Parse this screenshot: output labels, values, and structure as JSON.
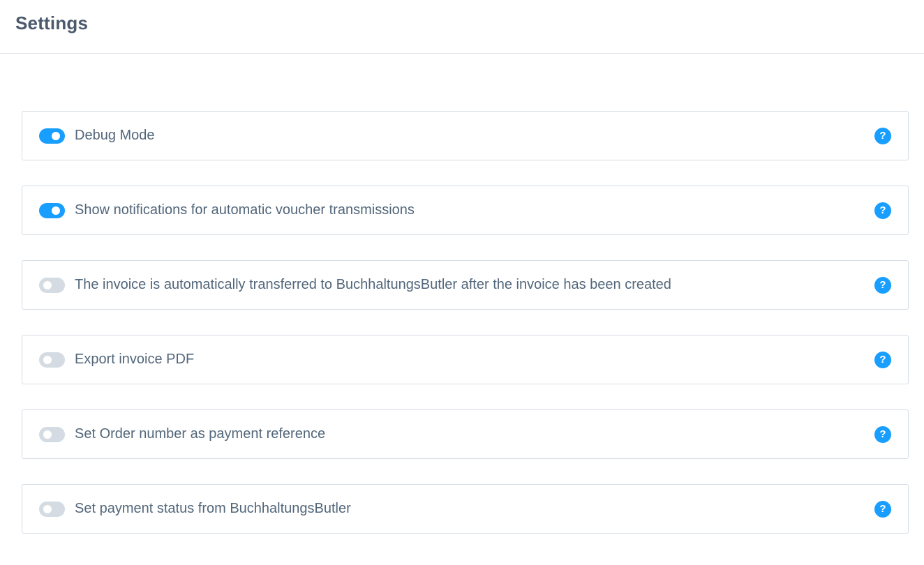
{
  "page": {
    "title": "Settings"
  },
  "colors": {
    "accent": "#189eff",
    "toggle_off": "#d4dbe3",
    "text": "#52667a",
    "border": "#d6dde4"
  },
  "settings": [
    {
      "label": "Debug Mode",
      "enabled": true,
      "help_icon": "question-circle-icon",
      "help_glyph": "?"
    },
    {
      "label": "Show notifications for automatic voucher transmissions",
      "enabled": true,
      "help_icon": "question-circle-icon",
      "help_glyph": "?"
    },
    {
      "label": "The invoice is automatically transferred to BuchhaltungsButler after the invoice has been created",
      "enabled": false,
      "help_icon": "question-circle-icon",
      "help_glyph": "?"
    },
    {
      "label": "Export invoice PDF",
      "enabled": false,
      "help_icon": "question-circle-icon",
      "help_glyph": "?"
    },
    {
      "label": "Set Order number as payment reference",
      "enabled": false,
      "help_icon": "question-circle-icon",
      "help_glyph": "?"
    },
    {
      "label": "Set payment status from BuchhaltungsButler",
      "enabled": false,
      "help_icon": "question-circle-icon",
      "help_glyph": "?"
    }
  ]
}
